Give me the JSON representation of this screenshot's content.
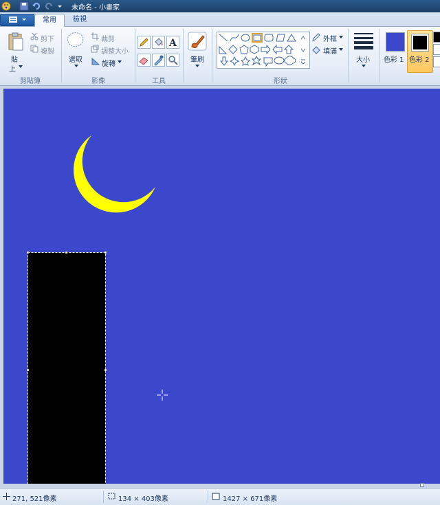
{
  "window": {
    "title": "未命名 - 小畫家"
  },
  "tabs": {
    "home": "常用",
    "view": "檢視"
  },
  "clipboard": {
    "paste_top": "貼",
    "paste_bottom": "上",
    "cut": "剪下",
    "copy": "複製",
    "group": "剪貼簿"
  },
  "image": {
    "select": "選取",
    "crop": "裁剪",
    "resize": "調整大小",
    "rotate": "旋轉",
    "group": "影像"
  },
  "tools": {
    "group": "工具"
  },
  "brushes": {
    "label": "筆刷"
  },
  "shapes": {
    "outline": "外框",
    "fill": "填滿",
    "group": "形狀"
  },
  "size": {
    "label": "大小"
  },
  "colors": {
    "color1_label": "色彩 1",
    "color2_label": "色彩 2",
    "color1": "#3c48cb",
    "color2": "#000000"
  },
  "canvas": {
    "background": "#3c48cb",
    "moon_color": "#ffff00",
    "selection_fill": "#000000"
  },
  "status": {
    "cursor_pos": "271, 521像素",
    "selection_size": "134 × 403像素",
    "image_size": "1427 × 671像素"
  }
}
